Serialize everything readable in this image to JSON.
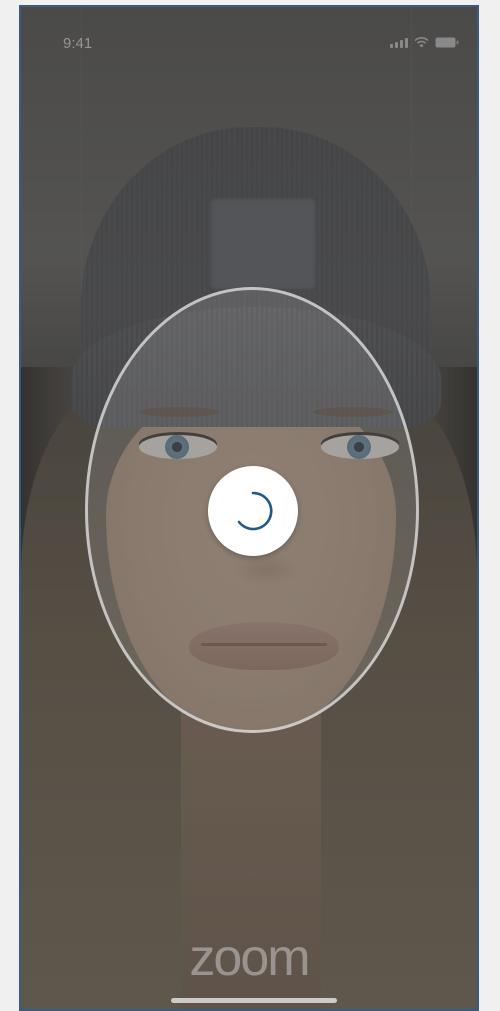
{
  "status_bar": {
    "time": "9:41",
    "icons": [
      "signal-icon",
      "wifi-icon",
      "battery-icon"
    ]
  },
  "face_capture": {
    "guide_shape": "oval",
    "state": "processing",
    "spinner_icon": "loading-spinner-icon"
  },
  "branding": {
    "logo_text": "zoom"
  },
  "colors": {
    "spinner_accent": "#1e5a8a",
    "frame_border": "#3a5a80",
    "guide_stroke": "#e1e1e1"
  }
}
